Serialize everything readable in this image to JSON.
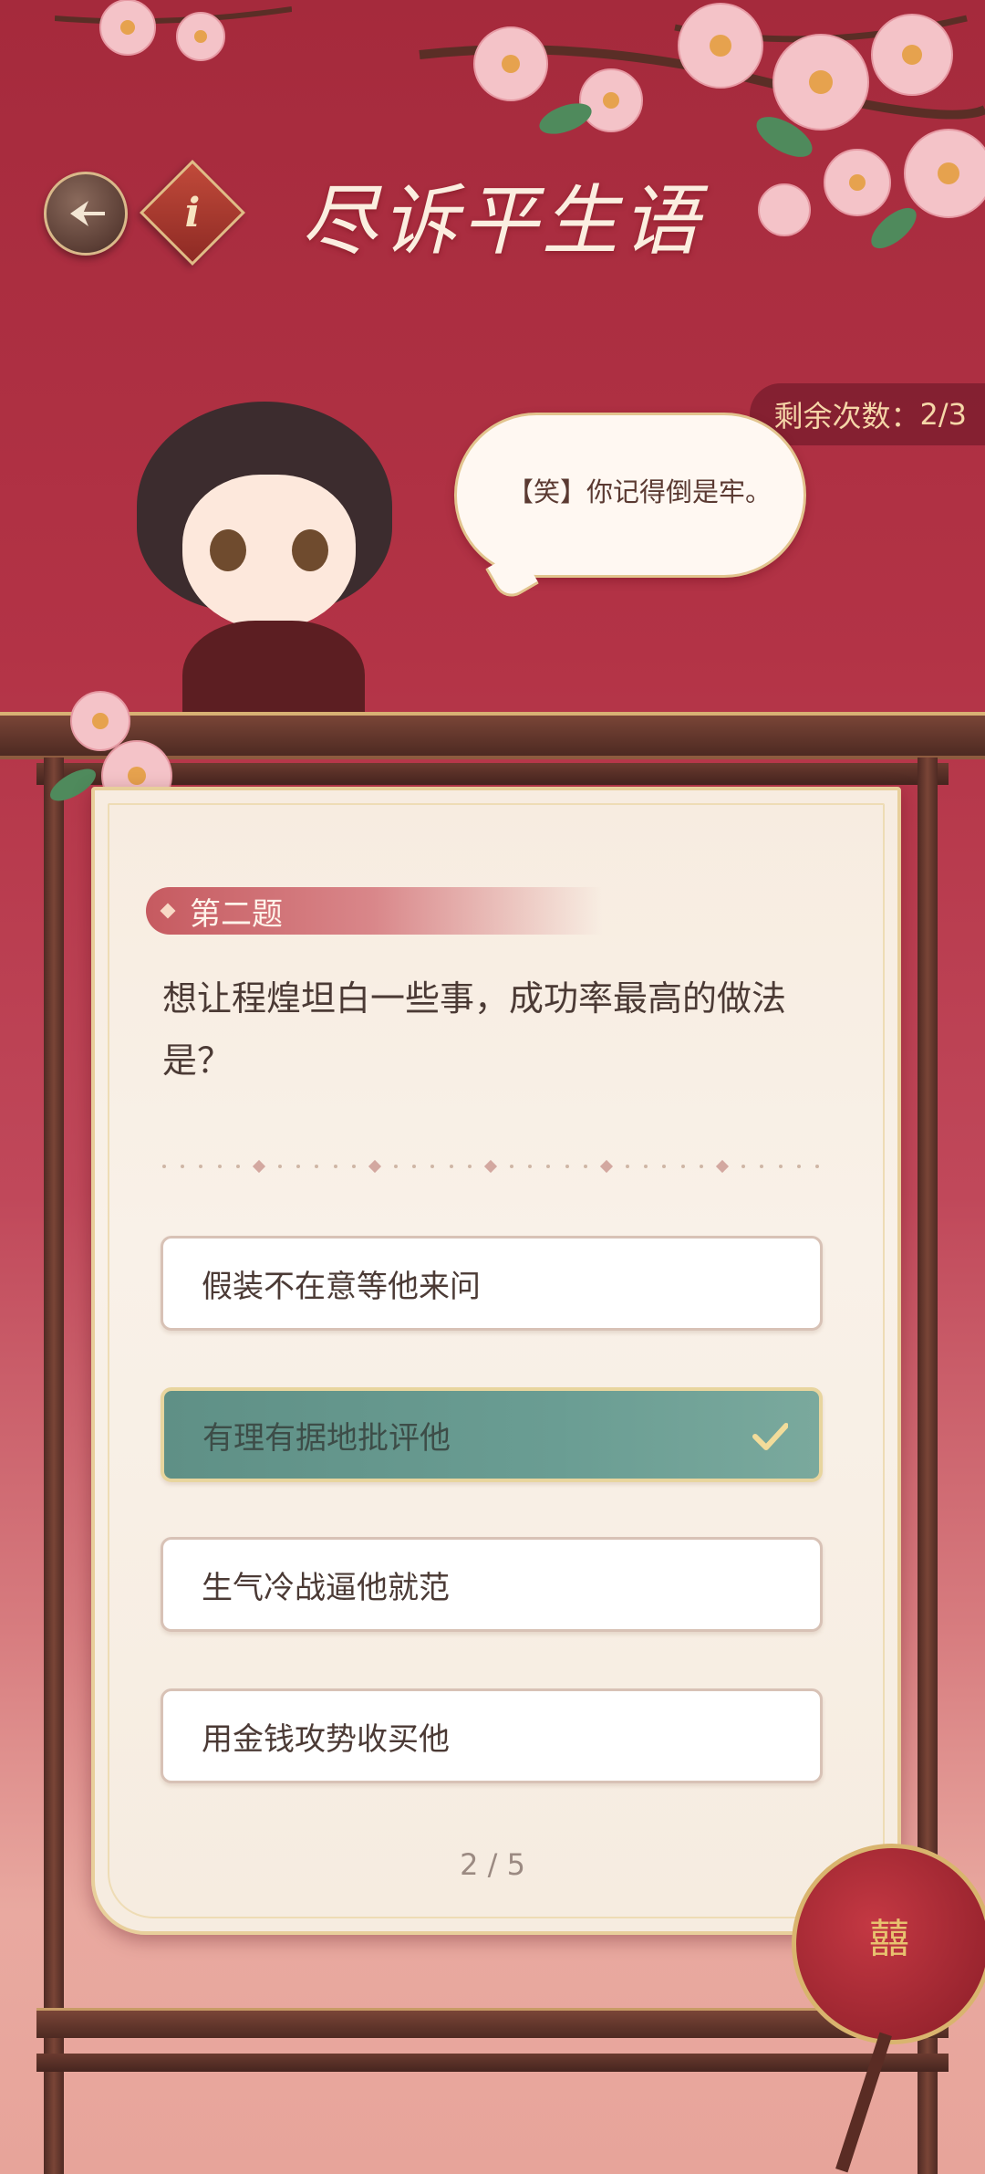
{
  "header": {
    "title": "尽诉平生语",
    "back_icon": "back-arrow-icon",
    "info_label": "i"
  },
  "remaining": {
    "label": "剩余次数：",
    "value": "2/3"
  },
  "speech": {
    "text": "【笑】你记得倒是牢。"
  },
  "question": {
    "number_label": "第二题",
    "text": "想让程煌坦白一些事，成功率最高的做法是？"
  },
  "options": [
    {
      "label": "假装不在意等他来问",
      "selected": false
    },
    {
      "label": "有理有据地批评他",
      "selected": true
    },
    {
      "label": "生气冷战逼他就范",
      "selected": false
    },
    {
      "label": "用金钱攻势收买他",
      "selected": false
    }
  ],
  "pager": {
    "text": "2 / 5"
  },
  "fan_symbol": "囍",
  "colors": {
    "background": "#a52a3c",
    "card": "#f7ece0",
    "selected_option": "#5f9086",
    "accent_gold": "#e8cf9b"
  }
}
